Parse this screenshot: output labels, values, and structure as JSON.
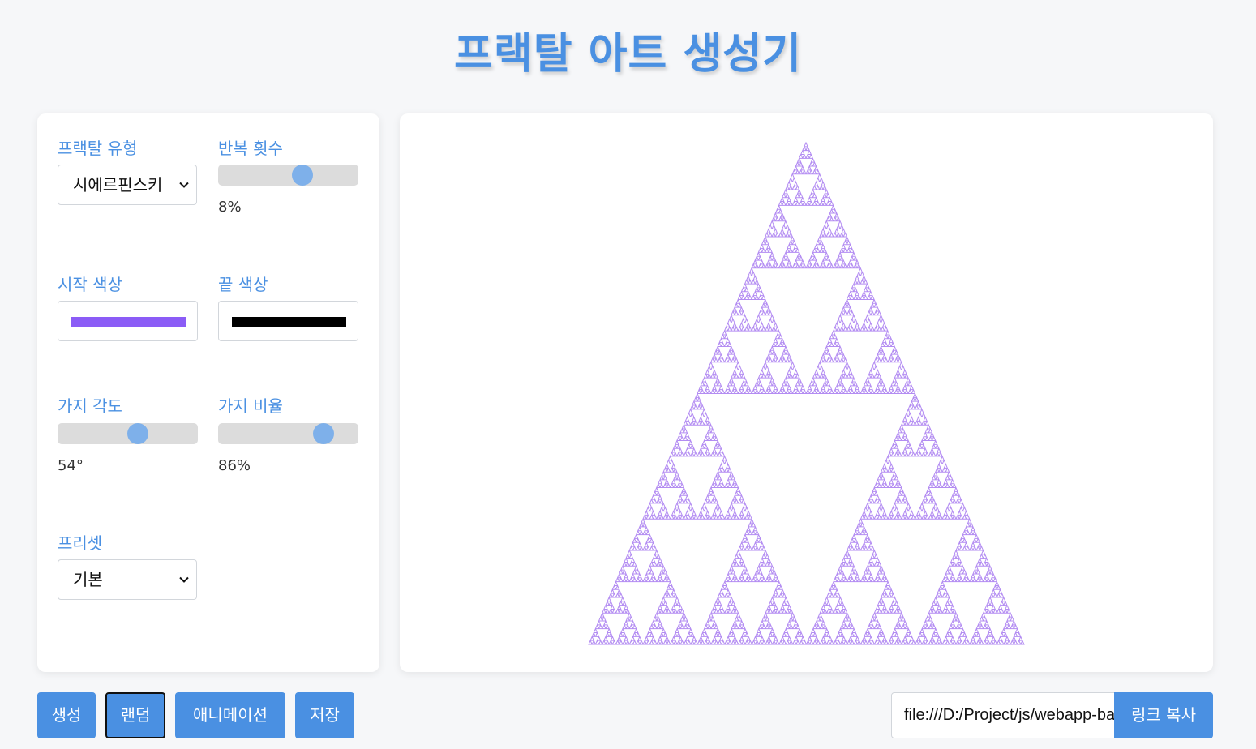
{
  "page_title": "프랙탈 아트 생성기",
  "controls": {
    "fractal_type": {
      "label": "프랙탈 유형",
      "value": "시에르핀스키"
    },
    "iterations": {
      "label": "반복 횟수",
      "value_text": "8%",
      "slider_fraction": 0.6
    },
    "start_color": {
      "label": "시작 색상",
      "value": "#8b5cf6"
    },
    "end_color": {
      "label": "끝 색상",
      "value": "#000000"
    },
    "branch_angle": {
      "label": "가지 각도",
      "value_text": "54°",
      "slider_fraction": 0.57
    },
    "branch_ratio": {
      "label": "가지 비율",
      "value_text": "86%",
      "slider_fraction": 0.75
    },
    "preset": {
      "label": "프리셋",
      "value": "기본"
    }
  },
  "buttons": {
    "generate": "생성",
    "random": "랜덤",
    "animation": "애니메이션",
    "save": "저장",
    "copy_link": "링크 복사"
  },
  "share_url": "file:///D:/Project/js/webapp-bakery/index.html",
  "colors": {
    "accent": "#4a90e2",
    "fractal_stroke": "#b38cf2",
    "slider_thumb": "#7eb0ea"
  },
  "fractal": {
    "type": "sierpinski",
    "depth": 7
  }
}
